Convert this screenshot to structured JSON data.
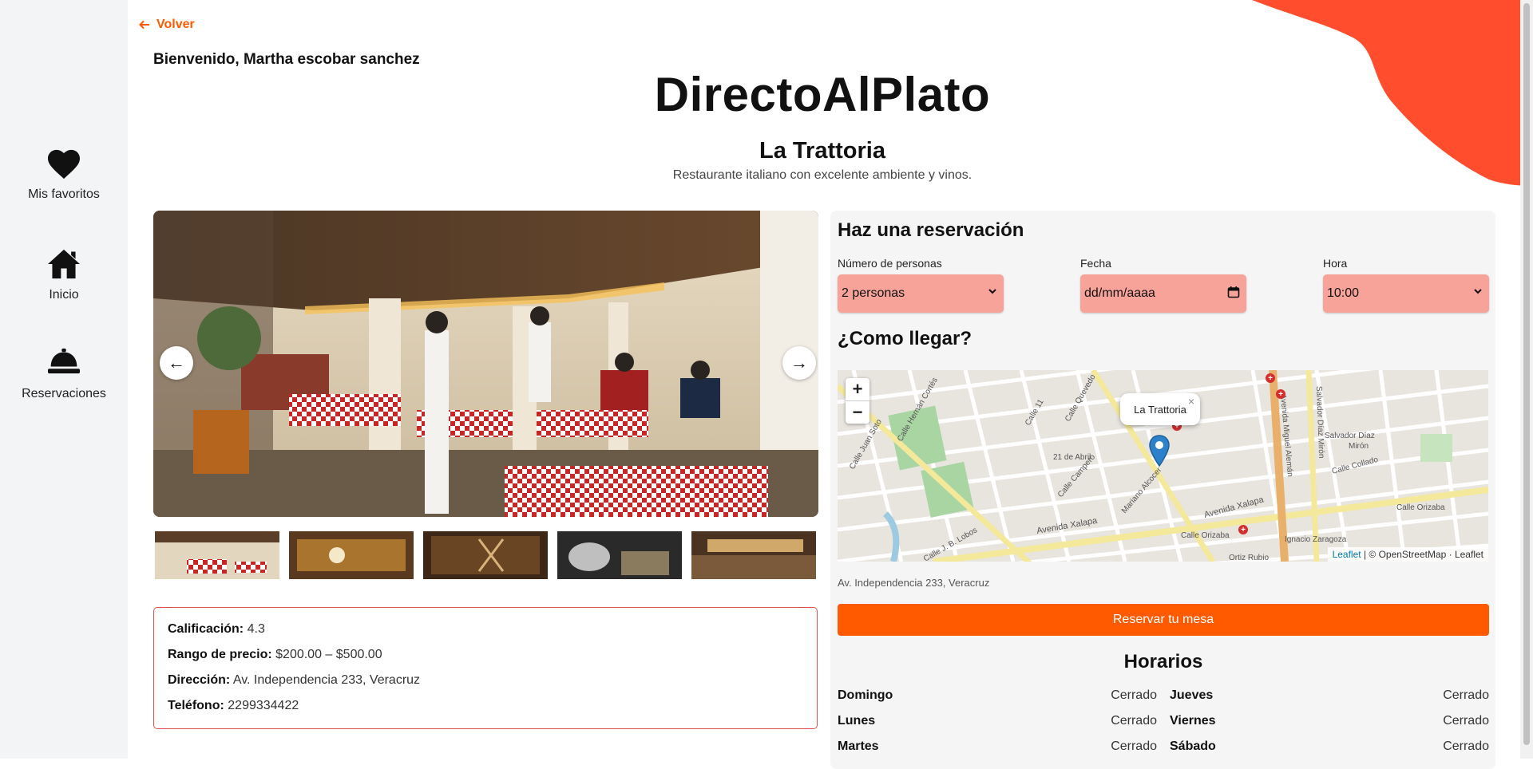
{
  "nav": {
    "back": "Volver",
    "sidebar": [
      {
        "label": "Mis favoritos",
        "icon": "heart-icon"
      },
      {
        "label": "Inicio",
        "icon": "home-icon"
      },
      {
        "label": "Reservaciones",
        "icon": "bell-icon"
      }
    ]
  },
  "header": {
    "welcome": "Bienvenido, Martha escobar sanchez",
    "brand": "DirectoAlPlato",
    "restaurant_name": "La Trattoria",
    "restaurant_description": "Restaurante italiano con excelente ambiente y vinos."
  },
  "carousel": {
    "prev_icon": "←",
    "next_icon": "→",
    "thumbnails": 5
  },
  "info": {
    "rating_label": "Calificación:",
    "rating_value": "4.3",
    "price_label": "Rango de precio:",
    "price_value": "$200.00 – $500.00",
    "address_label": "Dirección:",
    "address_value": "Av. Independencia 233, Veracruz",
    "phone_label": "Teléfono:",
    "phone_value": "2299334422"
  },
  "reservation": {
    "title": "Haz una reservación",
    "people_label": "Número de personas",
    "people_value": "2 personas",
    "date_label": "Fecha",
    "date_placeholder": "dd/mm/aaaa",
    "time_label": "Hora",
    "time_value": "10:00"
  },
  "map": {
    "title": "¿Como llegar?",
    "zoom_in": "+",
    "zoom_out": "−",
    "popup_label": "La Trattoria",
    "popup_close": "×",
    "attribution_leaflet": "Leaflet",
    "attribution_rest": "| © OpenStreetMap · Leaflet",
    "street_labels": [
      "Avenida Xalapa",
      "Avenida Miguel Alemán",
      "Salvador Díaz Mirón",
      "Calle J. B. Lobos",
      "21 de Abril",
      "Mariano Alcocer",
      "Calle Orizaba",
      "Ignacio Zaragoza",
      "Ortiz Rubio",
      "Calle Juan Soto",
      "Calle Hernán Cortés",
      "Calle 11",
      "Calle Campero",
      "Salvador Díaz Mirón",
      "Calle Collado"
    ]
  },
  "address_text": "Av. Independencia 233, Veracruz",
  "reserve_button": "Reservar tu mesa",
  "hours": {
    "title": "Horarios",
    "days": [
      {
        "day": "Domingo",
        "status": "Cerrado"
      },
      {
        "day": "Jueves",
        "status": "Cerrado"
      },
      {
        "day": "Lunes",
        "status": "Cerrado"
      },
      {
        "day": "Viernes",
        "status": "Cerrado"
      },
      {
        "day": "Martes",
        "status": "Cerrado"
      },
      {
        "day": "Sábado",
        "status": "Cerrado"
      }
    ]
  },
  "colors": {
    "accent": "#ff5a00",
    "field_bg": "#f8a39a",
    "info_border": "#e05050",
    "sidebar_bg": "#f3f4f6"
  }
}
